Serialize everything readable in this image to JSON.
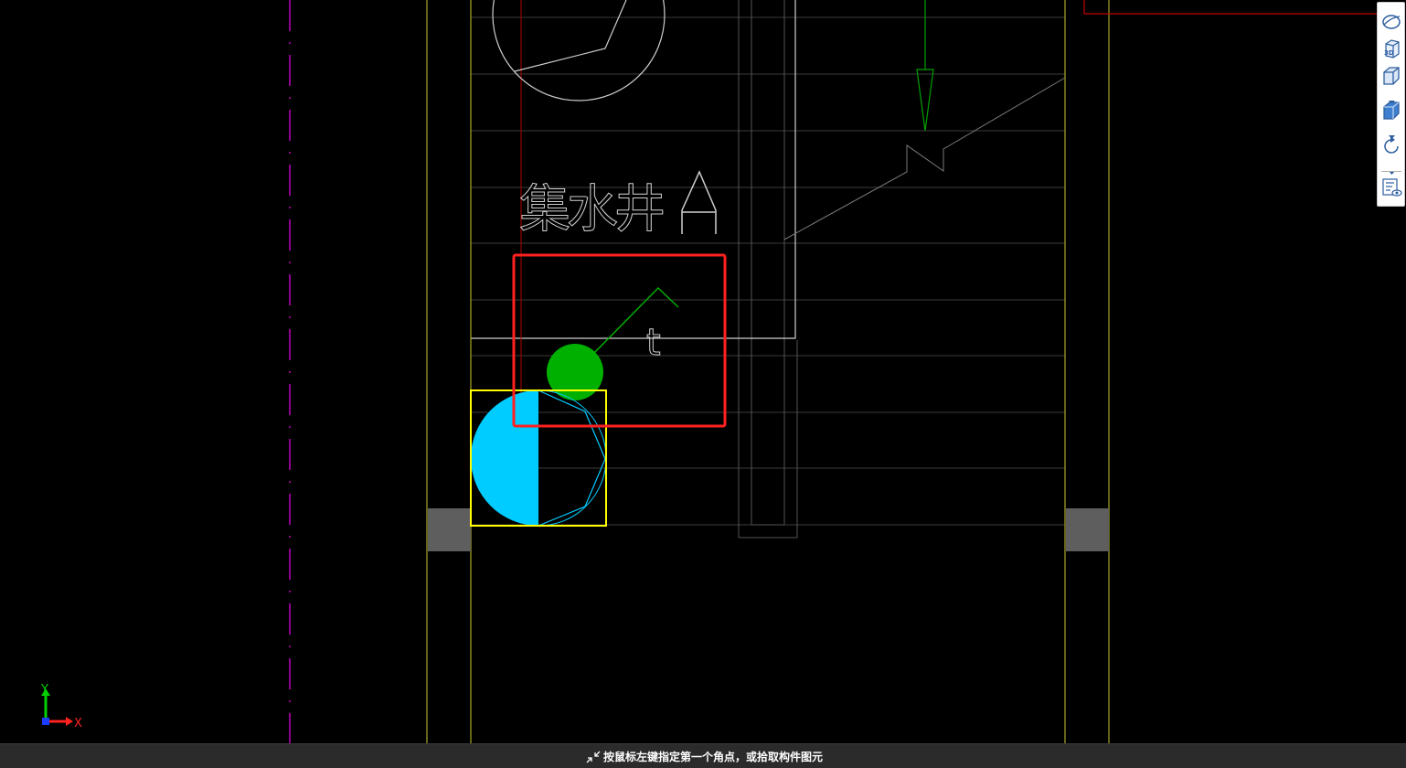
{
  "canvas": {
    "label_text": "集水井",
    "small_glyph": "t",
    "colors": {
      "background": "#000000",
      "axis_line": "#b7b72f",
      "grid_line": "#3f3f3f",
      "white_line": "#cfcfcf",
      "red_line": "#c00000",
      "magenta_line": "#c000c0",
      "green_line": "#00a000",
      "cyan_fill": "#00ccff",
      "yellow_box": "#ffff00",
      "selection_red": "#ff2020",
      "column_gray": "#5a5a5a"
    }
  },
  "axis_indicator": {
    "x_label": "X",
    "y_label": "Y"
  },
  "toolbar": {
    "buttons": [
      {
        "name": "dynamic-observe-icon"
      },
      {
        "name": "view-3d-icon",
        "text": "3D"
      },
      {
        "name": "view-cube-icon"
      },
      {
        "name": "display-cube-icon"
      },
      {
        "name": "rotate-icon"
      },
      {
        "name": "layer-display-icon"
      }
    ]
  },
  "statusbar": {
    "message": "按鼠标左键指定第一个角点，或拾取构件图元"
  }
}
